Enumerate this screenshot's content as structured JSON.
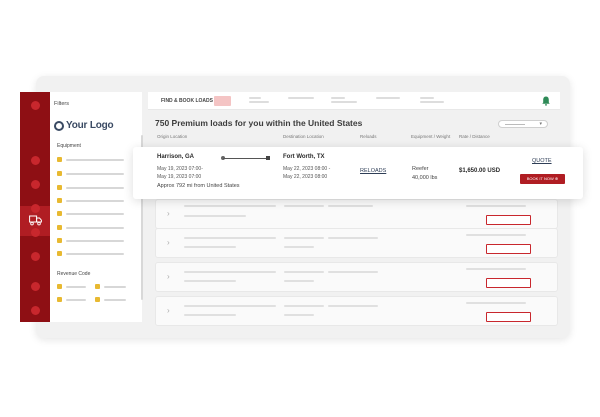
{
  "sidebar": {
    "filters_label": "Filters",
    "logo_text": "Your Logo",
    "equipment_label": "Equipment",
    "revenue_label": "Revenue Code"
  },
  "topbar": {
    "nav_label": "FIND & BOOK LOADS"
  },
  "main": {
    "heading": "750 Premium loads for you within the United States",
    "columns": {
      "origin": "Origin Location",
      "destination": "Destination Location",
      "reloads": "Reloads",
      "equipment": "Equipment / Weight",
      "rate": "Rate / Distance"
    }
  },
  "load": {
    "origin_city": "Harrison, GA",
    "origin_time_1": "May 19, 2023 07:00-",
    "origin_time_2": "May 19, 2023 07:00",
    "origin_distance": "Approx 792 mi from United States",
    "dest_city": "Fort Worth, TX",
    "dest_time_1": "May 22, 2023 08:00 -",
    "dest_time_2": "May 22, 2023 08:00",
    "reloads_link": "RELOADS",
    "equipment": "Reefer",
    "weight": "40,000 lbs",
    "price": "$1,650.00 USD",
    "quote_link": "QUOTE",
    "book_button": "BOOK IT NOW ⊕"
  },
  "icons": {
    "truck": "truck-icon",
    "bell": "bell-icon",
    "chevron": "chevron-right-icon"
  },
  "colors": {
    "rail": "#8e0f14",
    "accent": "#b01d23",
    "checkbox": "#e8b931",
    "bell": "#2e8a57"
  }
}
